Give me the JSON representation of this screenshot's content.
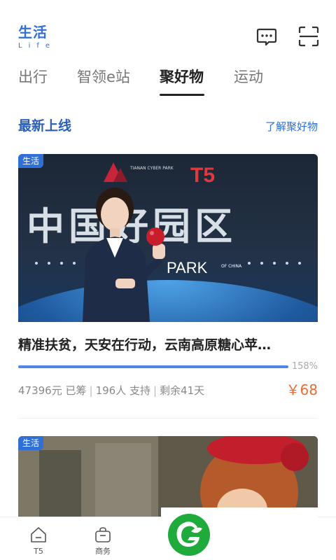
{
  "header": {
    "logo_cn": "生活",
    "logo_en": "Life",
    "icons": [
      "chat-icon",
      "scan-icon"
    ]
  },
  "tabs": [
    {
      "label": "出行",
      "active": false
    },
    {
      "label": "智领e站",
      "active": false
    },
    {
      "label": "聚好物",
      "active": true
    },
    {
      "label": "运动",
      "active": false
    }
  ],
  "section": {
    "title": "最新上线",
    "link": "了解聚好物"
  },
  "cards": [
    {
      "badge": "生活",
      "image_text": {
        "brand_small": "TIANAN CYBER PARK",
        "brand_t5": "T5",
        "headline": "中国好园区",
        "sub": "PARK",
        "sub_small": "OF CHINA"
      },
      "title": "精准扶贫，天安在行动，云南高原糖心苹…",
      "progress": 1.0,
      "progress_label": "158%",
      "raised": "47396元 已筹",
      "backers": "196人 支持",
      "days_left": "剩余41天",
      "price": "￥68"
    },
    {
      "badge": "生活"
    }
  ],
  "bottom_nav": [
    {
      "label": "T5",
      "icon": "home-icon"
    },
    {
      "label": "商务",
      "icon": "bag-icon"
    }
  ],
  "colors": {
    "accent": "#2f6fd6",
    "price": "#f06a35",
    "progress": "#4f86e8",
    "brand_green": "#1faa3c"
  }
}
